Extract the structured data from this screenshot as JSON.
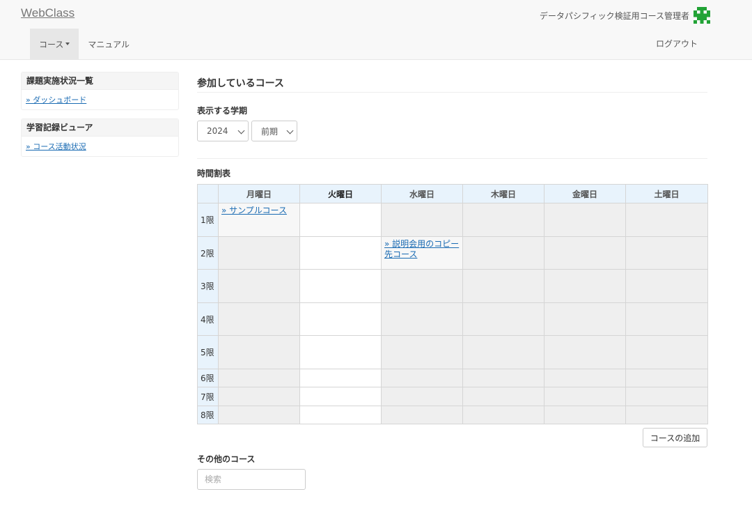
{
  "header": {
    "brand": "WebClass",
    "user_name": "データパシフィック検証用コース管理者",
    "avatar_icon": "identicon-avatar",
    "accent_color": "#22a336",
    "nav": [
      {
        "label": "コース",
        "active": true,
        "dropdown": true
      },
      {
        "label": "マニュアル",
        "active": false
      }
    ],
    "logout": "ログアウト"
  },
  "sidebar": {
    "panels": [
      {
        "title": "課題実施状況一覧",
        "link": "» ダッシュボード"
      },
      {
        "title": "学習記録ビューア",
        "link": "» コース活動状況"
      }
    ]
  },
  "main": {
    "title": "参加しているコース",
    "term_label": "表示する学期",
    "year_select": "2024",
    "term_select": "前期",
    "timetable_label": "時間割表",
    "days": [
      "月曜日",
      "火曜日",
      "水曜日",
      "木曜日",
      "金曜日",
      "土曜日"
    ],
    "highlight_day_index": 1,
    "periods": [
      "1限",
      "2限",
      "3限",
      "4限",
      "5限",
      "6限",
      "7限",
      "8限"
    ],
    "courses": [
      {
        "period": 0,
        "day": 0,
        "label": "» サンプルコース"
      },
      {
        "period": 1,
        "day": 2,
        "label": "» 説明会用のコピー先コース"
      }
    ],
    "add_course_button": "コースの追加",
    "other_courses_label": "その他のコース",
    "search_placeholder": "検索"
  }
}
